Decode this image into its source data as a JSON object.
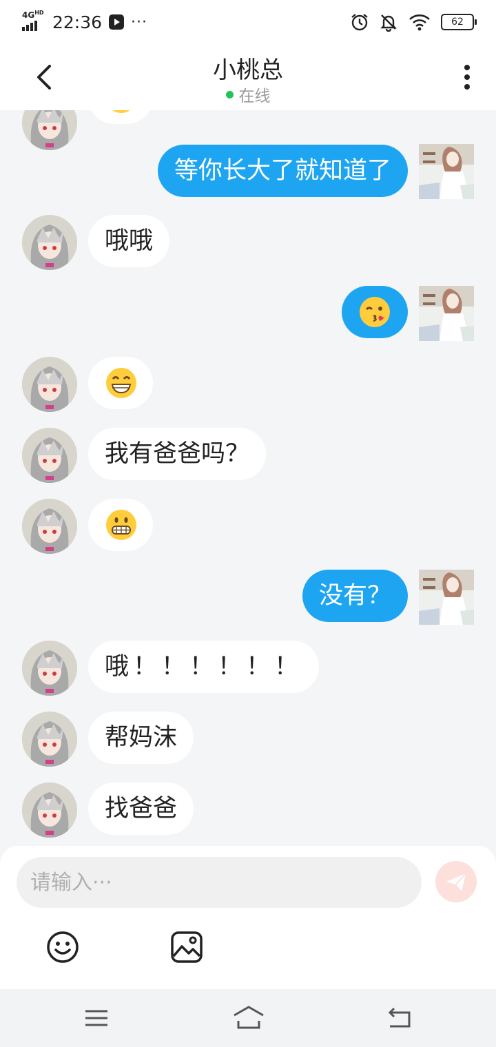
{
  "status_bar": {
    "network": "4G",
    "network_sup": "HD",
    "time": "22:36",
    "more": "···",
    "battery": "62"
  },
  "header": {
    "title": "小桃总",
    "status": "在线"
  },
  "messages": [
    {
      "side": "left",
      "type": "emoji",
      "emoji": "partially-hidden-emoji"
    },
    {
      "side": "right",
      "type": "text",
      "text": "等你长大了就知道了"
    },
    {
      "side": "left",
      "type": "text",
      "text": "哦哦"
    },
    {
      "side": "right",
      "type": "emoji",
      "emoji": "kissing-face-emoji"
    },
    {
      "side": "left",
      "type": "emoji",
      "emoji": "grinning-face-emoji"
    },
    {
      "side": "left",
      "type": "text",
      "text": "我有爸爸吗？"
    },
    {
      "side": "left",
      "type": "emoji",
      "emoji": "grimacing-face-emoji"
    },
    {
      "side": "right",
      "type": "text",
      "text": "没有？"
    },
    {
      "side": "left",
      "type": "text",
      "text": "哦！！！！！！"
    },
    {
      "side": "left",
      "type": "text",
      "text": "帮妈沫"
    },
    {
      "side": "left",
      "type": "text",
      "text": "找爸爸"
    }
  ],
  "input": {
    "placeholder": "请输入···"
  },
  "toolbar": {
    "emoji_icon": "smiley-icon",
    "image_icon": "image-icon",
    "send_icon": "paper-plane-icon"
  },
  "navbar": {
    "menu_icon": "menu-icon",
    "home_icon": "home-icon",
    "back_icon": "back-icon"
  },
  "colors": {
    "accent_blue": "#1ea5f2",
    "online_green": "#21c35a",
    "send_button": "#fde0dc",
    "chat_background": "#f4f5f7"
  }
}
